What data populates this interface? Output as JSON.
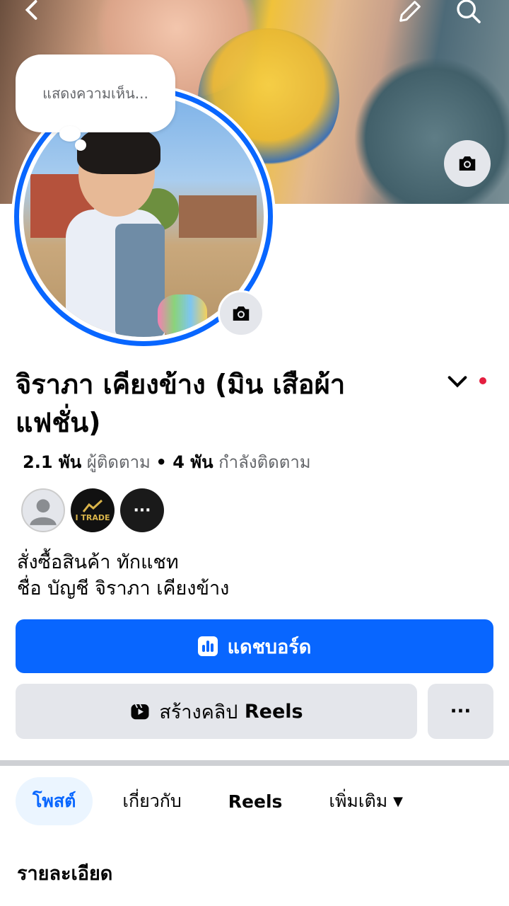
{
  "cover": {
    "camera_icon": "camera-icon"
  },
  "header_icons": {
    "back": "chevron-left-icon",
    "edit": "pencil-icon",
    "search": "search-icon"
  },
  "bubble": {
    "text": "แสดงความเห็น..."
  },
  "profile": {
    "name": "จิราภา เคียงข้าง (มิน เสือผ้า แฟชั่น)",
    "followers_count": "2.1 พัน",
    "followers_label": "ผู้ติดตาม",
    "following_count": "4 พัน",
    "following_label": "กำลังติดตาม",
    "bio_line1": "สั่งซื้อสินค้า ทักแชท",
    "bio_line2": "ชื่อ บัญชี จิราภา เคียงข้าง"
  },
  "friends": {
    "badge2": "I TRADE",
    "more": "···"
  },
  "buttons": {
    "dashboard": "แดชบอร์ด",
    "reels_prefix": "สร้างคลิป",
    "reels_suffix": "Reels",
    "more": "···"
  },
  "tabs": [
    {
      "label": "โพสต์"
    },
    {
      "label": "เกี่ยวกับ"
    },
    {
      "label": "Reels"
    },
    {
      "label": "เพิ่มเติม"
    }
  ],
  "section_title": "รายละเอียด",
  "colors": {
    "accent": "#0866ff",
    "notification": "#e41e3f"
  }
}
